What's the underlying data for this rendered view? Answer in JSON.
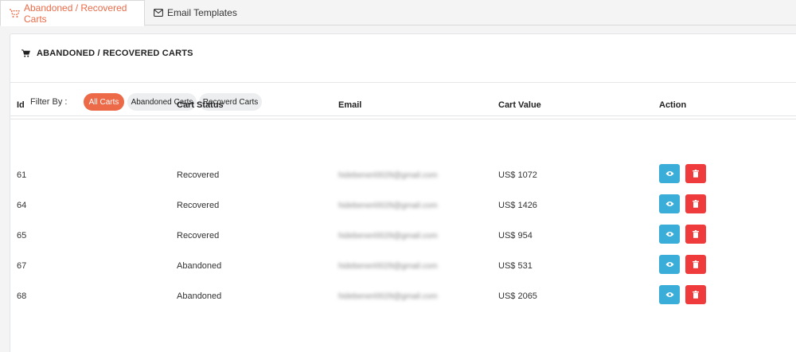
{
  "tabs": [
    {
      "label": "Abandoned / Recovered Carts",
      "active": true,
      "icon": "cart-icon"
    },
    {
      "label": "Email Templates",
      "active": false,
      "icon": "envelope-icon"
    }
  ],
  "card": {
    "title": "ABANDONED / RECOVERED CARTS",
    "title_icon": "shopping-cart-icon"
  },
  "filter": {
    "label": "Filter By :",
    "options": [
      "All Carts",
      "Abandoned Carts",
      "Recoverd Carts"
    ],
    "selected": "All Carts"
  },
  "table": {
    "headers": [
      "Id",
      "Cart Status",
      "Email",
      "Cart Value",
      "Action"
    ],
    "rows": [
      {
        "id": "61",
        "status": "Recovered",
        "email": "hidebeneri0029@gmail.com",
        "value": "US$ 1072"
      },
      {
        "id": "64",
        "status": "Recovered",
        "email": "hidebeneri0029@gmail.com",
        "value": "US$ 1426"
      },
      {
        "id": "65",
        "status": "Recovered",
        "email": "hidebeneri0029@gmail.com",
        "value": "US$ 954"
      },
      {
        "id": "67",
        "status": "Abandoned",
        "email": "hidebeneri0029@gmail.com",
        "value": "US$ 531"
      },
      {
        "id": "68",
        "status": "Abandoned",
        "email": "hidebeneri0029@gmail.com",
        "value": "US$ 2065"
      }
    ],
    "actions": {
      "view_icon": "eye-icon",
      "delete_icon": "trash-icon"
    }
  },
  "colors": {
    "accent": "#ec6a47",
    "view_button": "#3aaed8",
    "delete_button": "#ef3b3b"
  }
}
